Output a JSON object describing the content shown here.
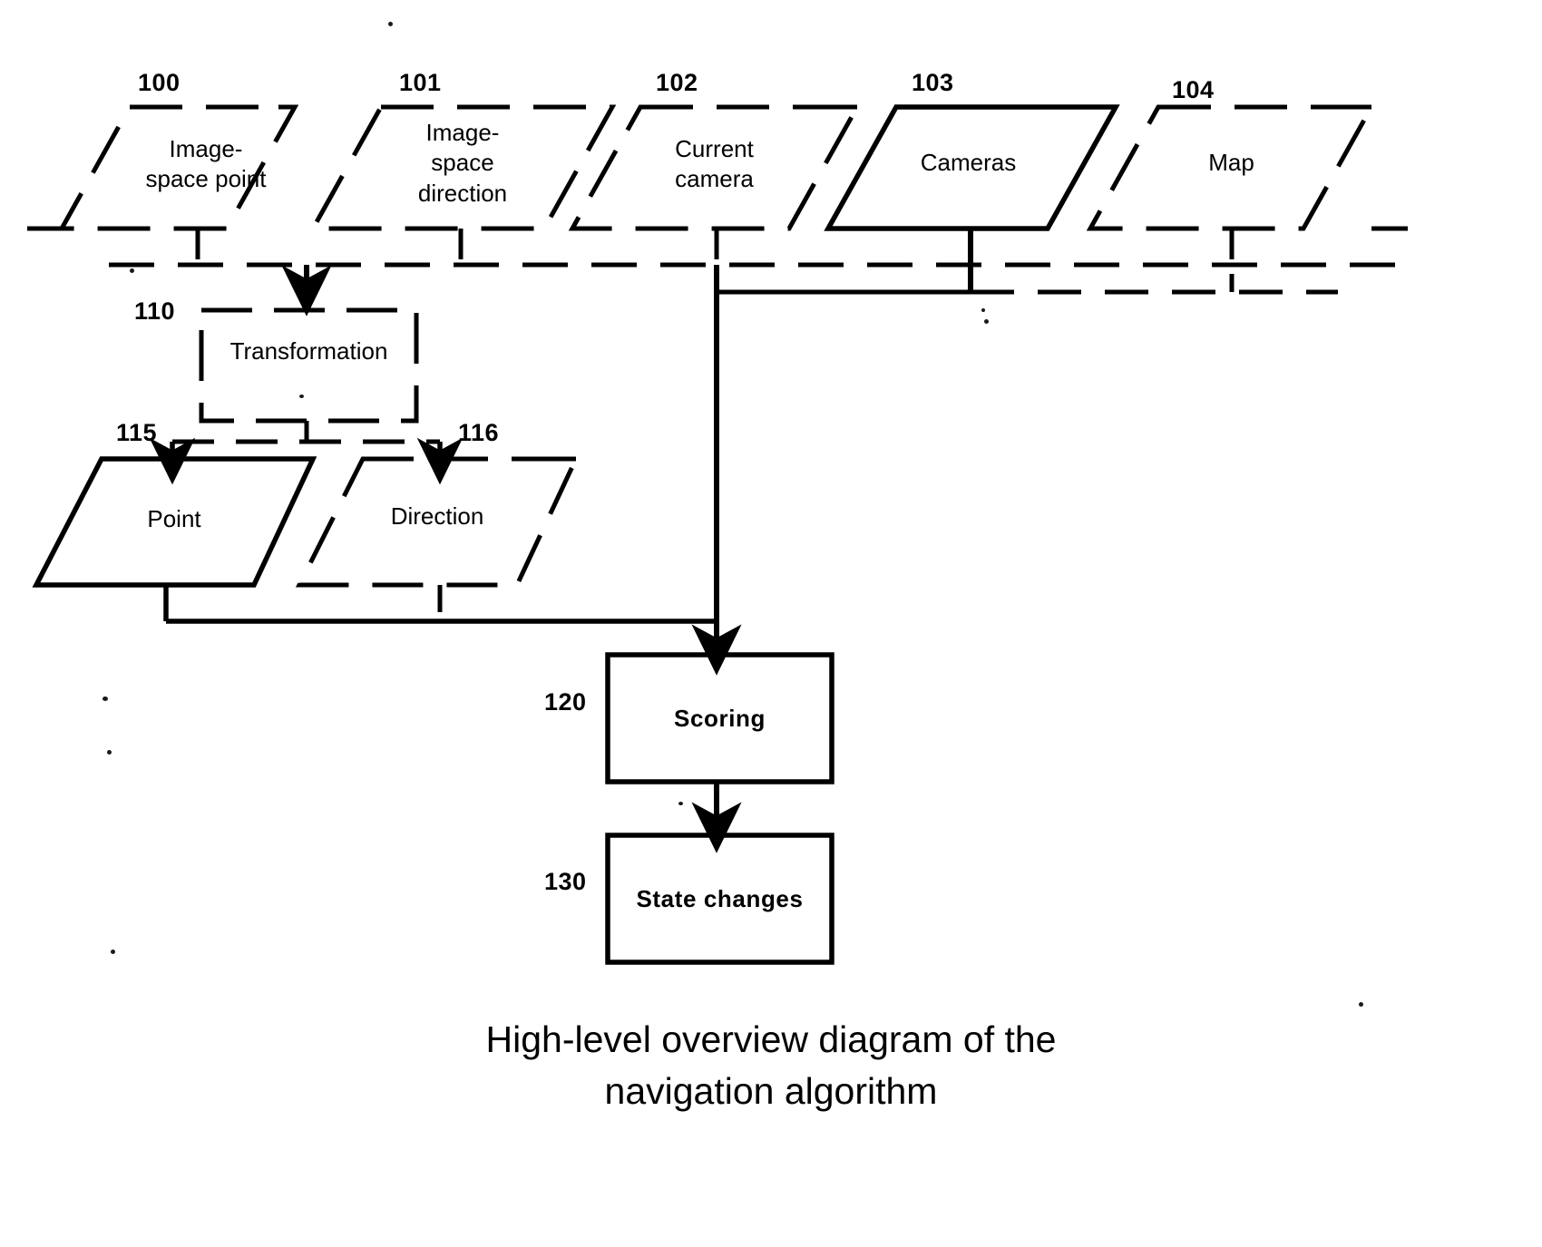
{
  "figure": {
    "caption": "High-level overview diagram of the\nnavigation algorithm",
    "type": "patent-flowchart",
    "background_color": "#ffffff",
    "line_color": "#000000"
  },
  "nodes": [
    {
      "ref": "100",
      "label": "Image-\nspace point",
      "shape": "parallelogram",
      "border": "dashed",
      "bold_text": false,
      "role": "data-input"
    },
    {
      "ref": "101",
      "label": "Image-\nspace\ndirection",
      "shape": "parallelogram",
      "border": "dashed",
      "bold_text": false,
      "role": "data-input"
    },
    {
      "ref": "102",
      "label": "Current\ncamera",
      "shape": "parallelogram",
      "border": "dashed",
      "bold_text": false,
      "role": "data-input"
    },
    {
      "ref": "103",
      "label": "Cameras",
      "shape": "parallelogram",
      "border": "solid",
      "bold_text": false,
      "role": "data-input"
    },
    {
      "ref": "104",
      "label": "Map",
      "shape": "parallelogram",
      "border": "dashed",
      "bold_text": false,
      "role": "data-input"
    },
    {
      "ref": "110",
      "label": "Transformation",
      "shape": "rectangle",
      "border": "dashed",
      "bold_text": false,
      "role": "process"
    },
    {
      "ref": "115",
      "label": "Point",
      "shape": "parallelogram",
      "border": "solid",
      "bold_text": false,
      "role": "data-intermediate"
    },
    {
      "ref": "116",
      "label": "Direction",
      "shape": "parallelogram",
      "border": "dashed",
      "bold_text": false,
      "role": "data-intermediate"
    },
    {
      "ref": "120",
      "label": "Scoring",
      "shape": "rectangle",
      "border": "solid",
      "bold_text": true,
      "role": "process"
    },
    {
      "ref": "130",
      "label": "State changes",
      "shape": "rectangle",
      "border": "solid",
      "bold_text": true,
      "role": "process"
    }
  ],
  "edges": [
    {
      "from": "100",
      "to": "110",
      "style": "dashed",
      "arrow": true
    },
    {
      "from": "101",
      "to": "110",
      "style": "dashed",
      "arrow": true
    },
    {
      "from": "110",
      "to": "115",
      "style": "dashed",
      "arrow": true
    },
    {
      "from": "110",
      "to": "116",
      "style": "dashed",
      "arrow": true
    },
    {
      "from": "102",
      "to": "120",
      "style": "solid",
      "arrow": true
    },
    {
      "from": "103",
      "to": "120",
      "style": "solid",
      "arrow": true
    },
    {
      "from": "104",
      "to": "120",
      "style": "dashed",
      "arrow": true
    },
    {
      "from": "115",
      "to": "120",
      "style": "solid",
      "arrow": true
    },
    {
      "from": "116",
      "to": "120",
      "style": "dashed",
      "arrow": true
    },
    {
      "from": "120",
      "to": "130",
      "style": "solid",
      "arrow": true
    }
  ]
}
